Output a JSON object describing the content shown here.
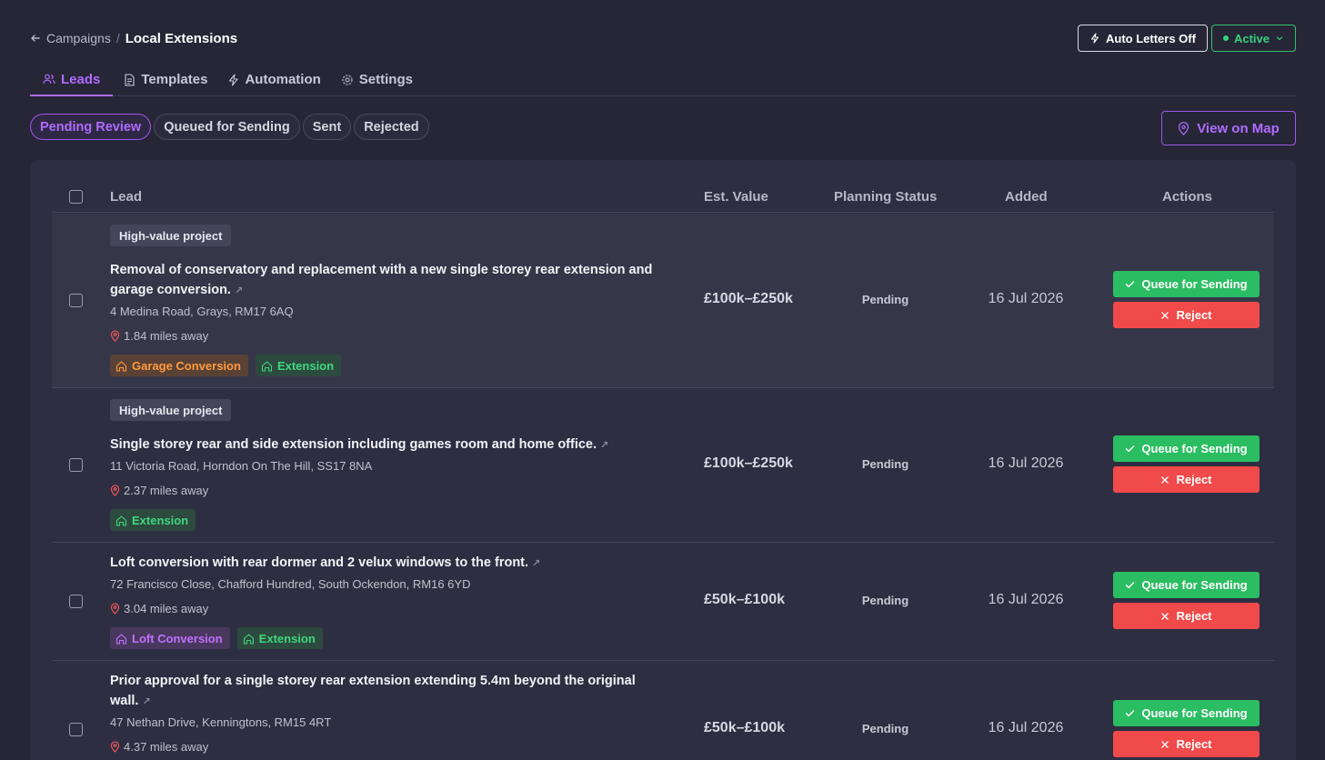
{
  "breadcrumb": {
    "parent": "Campaigns",
    "separator": "/",
    "current": "Local Extensions"
  },
  "header": {
    "auto_letters": "Auto Letters Off",
    "status": "Active"
  },
  "tabs": [
    {
      "label": "Leads",
      "icon": "users-icon"
    },
    {
      "label": "Templates",
      "icon": "file-icon"
    },
    {
      "label": "Automation",
      "icon": "bolt-icon"
    },
    {
      "label": "Settings",
      "icon": "gear-icon"
    }
  ],
  "filters": [
    "Pending Review",
    "Queued for Sending",
    "Sent",
    "Rejected"
  ],
  "map_button": "View on Map",
  "table": {
    "columns": {
      "lead": "Lead",
      "value": "Est. Value",
      "planning": "Planning Status",
      "added": "Added",
      "actions": "Actions"
    },
    "queue_label": "Queue for Sending",
    "reject_label": "Reject",
    "rows": [
      {
        "badge": "High-value project",
        "title_l1": "Removal of conservatory and replacement with a new single storey rear extension and",
        "title_l2": "garage conversion.",
        "address": "4 Medina Road, Grays, RM17 6AQ",
        "distance": "1.84 miles away",
        "tags": [
          "Garage Conversion",
          "Extension"
        ],
        "value": "£100k–£250k",
        "status": "Pending",
        "added": "16 Jul 2026"
      },
      {
        "badge": "High-value project",
        "title_l1": "Single storey rear and side extension including games room and home office.",
        "address": "11 Victoria Road, Horndon On The Hill, SS17 8NA",
        "distance": "2.37 miles away",
        "tags": [
          "Extension"
        ],
        "value": "£100k–£250k",
        "status": "Pending",
        "added": "16 Jul 2026"
      },
      {
        "title_l1": "Loft conversion with rear dormer and 2 velux windows to the front.",
        "address": "72 Francisco Close, Chafford Hundred, South Ockendon, RM16 6YD",
        "distance": "3.04 miles away",
        "tags": [
          "Loft Conversion",
          "Extension"
        ],
        "value": "£50k–£100k",
        "status": "Pending",
        "added": "16 Jul 2026"
      },
      {
        "title_l1": "Prior approval for a single storey rear extension extending 5.4m beyond the original",
        "title_l2": "wall.",
        "address": "47 Nethan Drive, Kenningtons, RM15 4RT",
        "distance": "4.37 miles away",
        "value": "£50k–£100k",
        "status": "Pending",
        "added": "16 Jul 2026"
      }
    ]
  },
  "colors": {
    "accent": "#b06cff",
    "success": "#2bbd62",
    "danger": "#f04a4a",
    "background": "#262637"
  }
}
